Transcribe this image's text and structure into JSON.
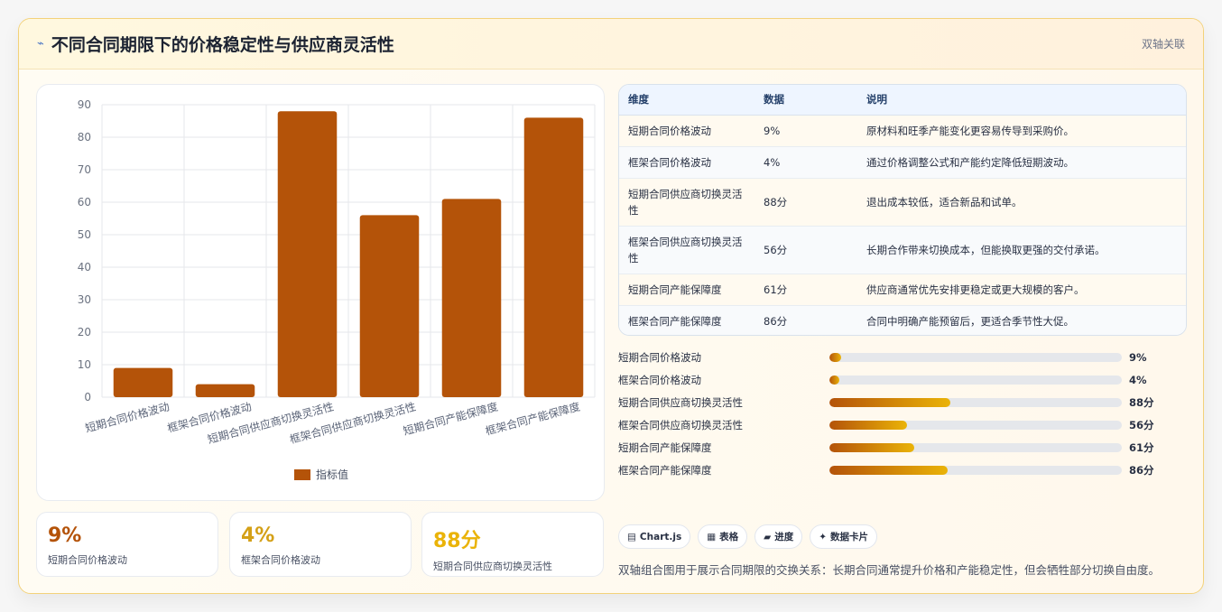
{
  "header": {
    "icon": "trend-icon",
    "title": "不同合同期限下的价格稳定性与供应商灵活性",
    "badge": "双轴关联"
  },
  "chart_data": {
    "type": "bar",
    "categories": [
      "短期合同价格波动",
      "框架合同价格波动",
      "短期合同供应商切换灵活性",
      "框架合同供应商切换灵活性",
      "短期合同产能保障度",
      "框架合同产能保障度"
    ],
    "series": [
      {
        "name": "指标值",
        "values": [
          9,
          4,
          88,
          56,
          61,
          86
        ],
        "color": "#b45309"
      }
    ],
    "ylim": [
      0,
      90
    ],
    "yticks": [
      0,
      10,
      20,
      30,
      40,
      50,
      60,
      70,
      80,
      90
    ],
    "grid": true,
    "legend": "bottom"
  },
  "kpis": [
    {
      "value": "9%",
      "label": "短期合同价格波动",
      "color": "#b45309"
    },
    {
      "value": "4%",
      "label": "框架合同价格波动",
      "color": "#d4a017"
    },
    {
      "value": "88分",
      "label": "短期合同供应商切换灵活性",
      "color": "#eab308"
    }
  ],
  "table": {
    "headers": [
      "维度",
      "数据",
      "说明"
    ],
    "rows": [
      [
        "短期合同价格波动",
        "9%",
        "原材料和旺季产能变化更容易传导到采购价。"
      ],
      [
        "框架合同价格波动",
        "4%",
        "通过价格调整公式和产能约定降低短期波动。"
      ],
      [
        "短期合同供应商切换灵活性",
        "88分",
        "退出成本较低，适合新品和试单。"
      ],
      [
        "框架合同供应商切换灵活性",
        "56分",
        "长期合作带来切换成本，但能换取更强的交付承诺。"
      ],
      [
        "短期合同产能保障度",
        "61分",
        "供应商通常优先安排更稳定或更大规模的客户。"
      ],
      [
        "框架合同产能保障度",
        "86分",
        "合同中明确产能预留后，更适合季节性大促。"
      ]
    ]
  },
  "progress": [
    {
      "label": "短期合同价格波动",
      "value": "9%",
      "fraction": 0.04
    },
    {
      "label": "框架合同价格波动",
      "value": "4%",
      "fraction": 0.035
    },
    {
      "label": "短期合同供应商切换灵活性",
      "value": "88分",
      "fraction": 0.415
    },
    {
      "label": "框架合同供应商切换灵活性",
      "value": "56分",
      "fraction": 0.265
    },
    {
      "label": "短期合同产能保障度",
      "value": "61分",
      "fraction": 0.29
    },
    {
      "label": "框架合同产能保障度",
      "value": "86分",
      "fraction": 0.405
    }
  ],
  "chips": [
    {
      "icon": "chart-icon",
      "glyph": "▤",
      "label": "Chart.js"
    },
    {
      "icon": "table-icon",
      "glyph": "▦",
      "label": "表格"
    },
    {
      "icon": "progress-icon",
      "glyph": "▰",
      "label": "进度"
    },
    {
      "icon": "sparkle-icon",
      "glyph": "✦",
      "label": "数据卡片"
    }
  ],
  "note": "双轴组合图用于展示合同期限的交换关系：长期合同通常提升价格和产能稳定性，但会牺牲部分切换自由度。"
}
